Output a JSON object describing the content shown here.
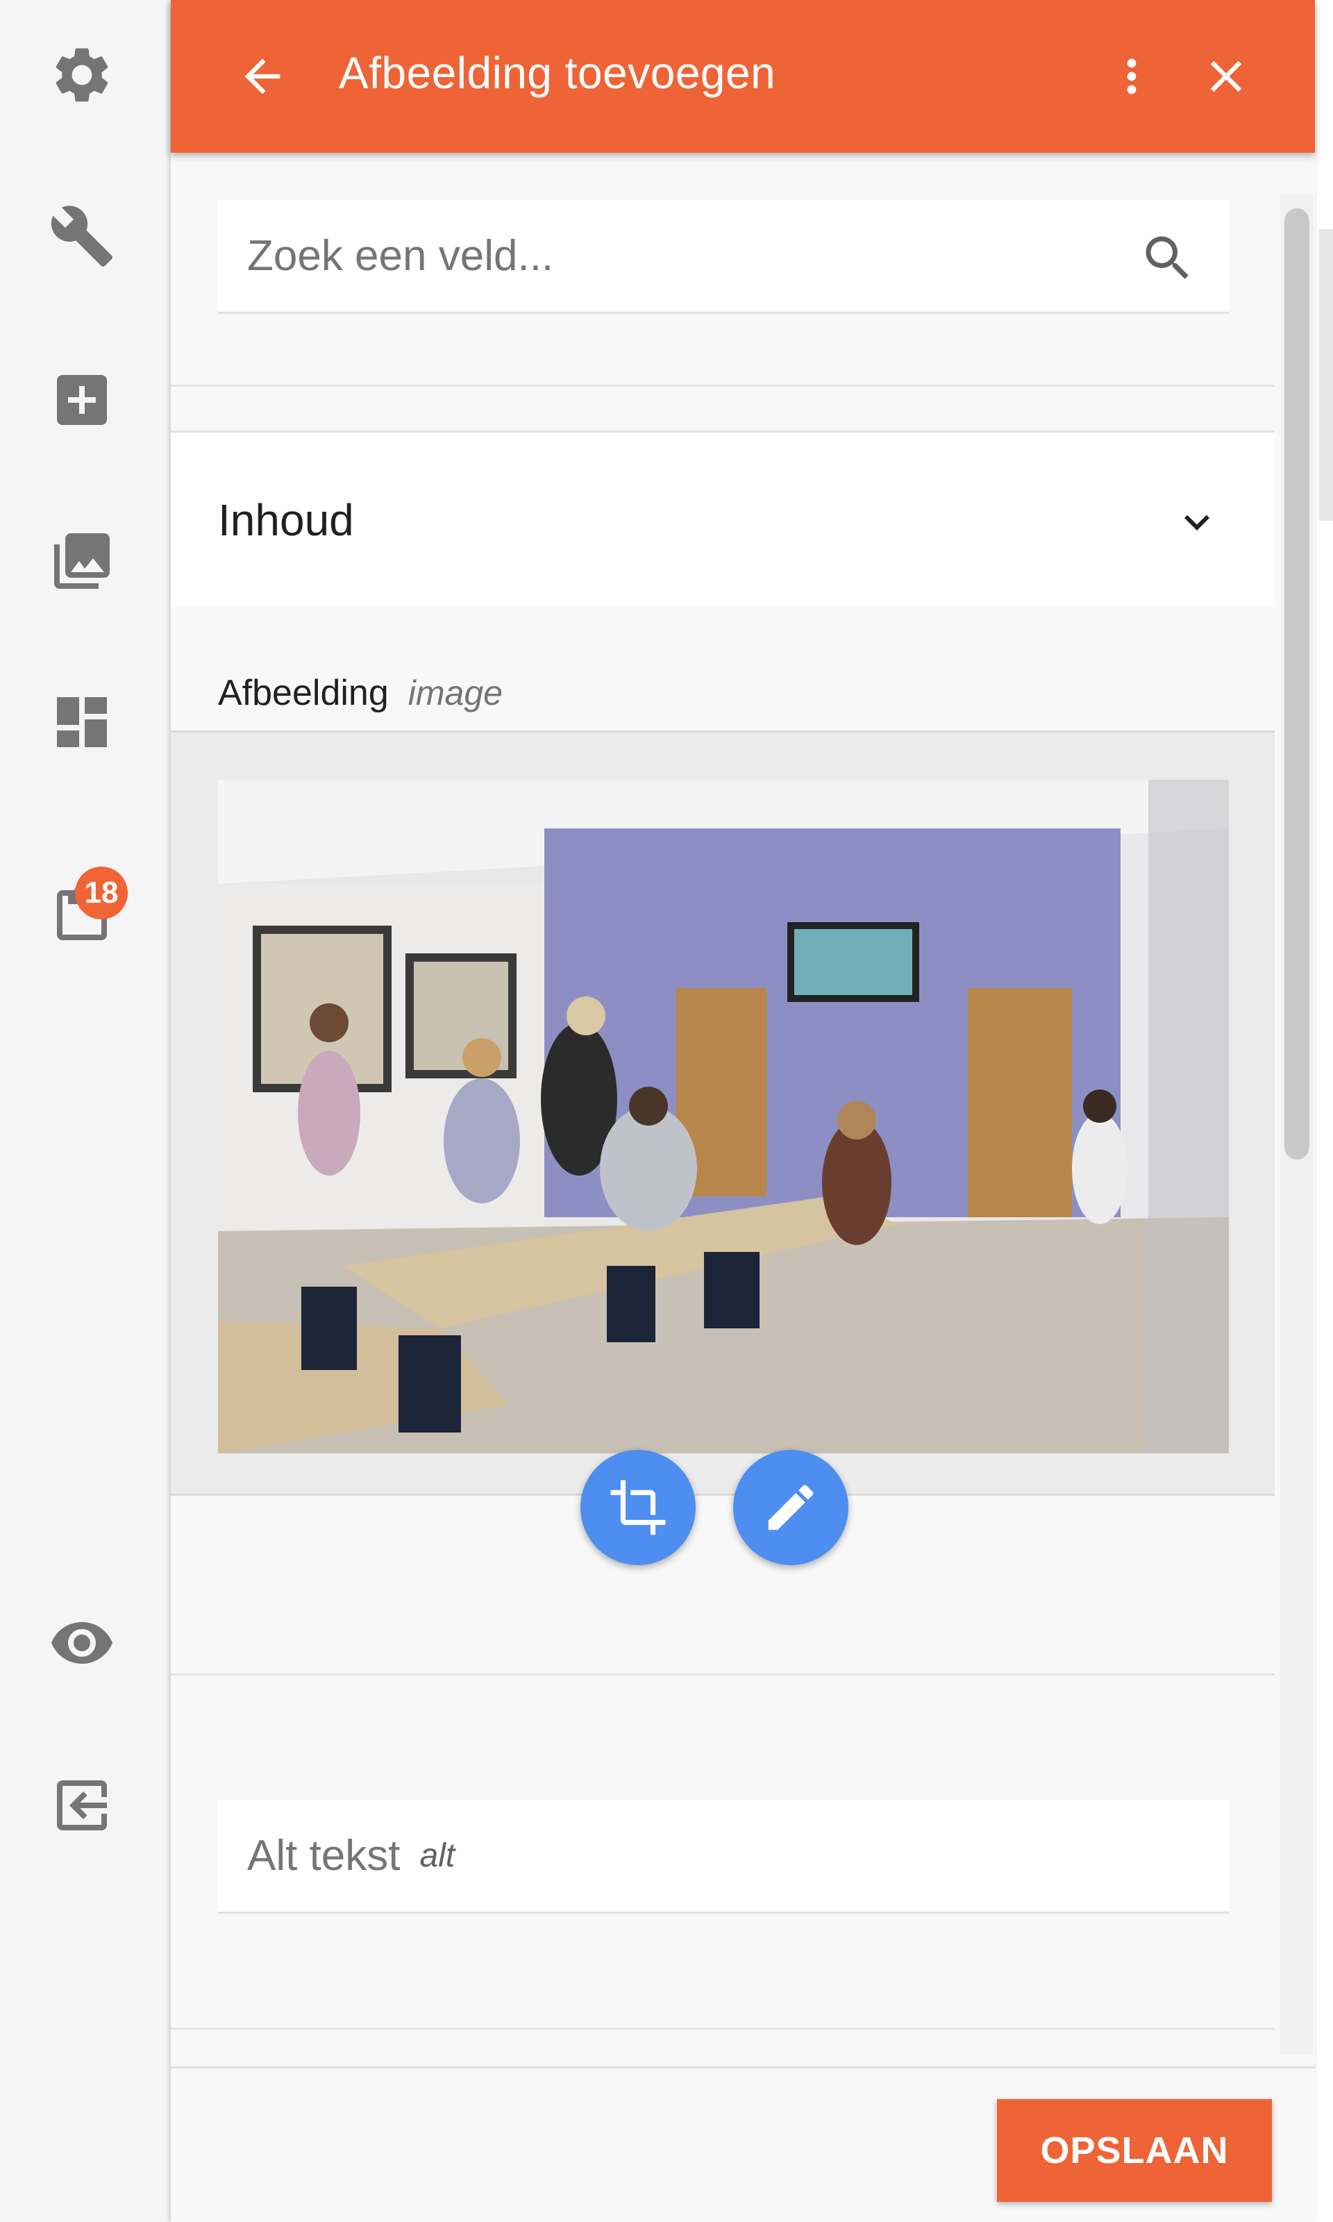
{
  "sidebar": {
    "items": [
      {
        "icon": "settings-icon"
      },
      {
        "icon": "wrench-icon"
      },
      {
        "icon": "add-box-icon"
      },
      {
        "icon": "photo-library-icon"
      },
      {
        "icon": "dashboard-icon"
      },
      {
        "icon": "clipboard-icon",
        "badge": "18"
      },
      {
        "icon": "eye-icon"
      },
      {
        "icon": "logout-icon"
      }
    ]
  },
  "panel": {
    "title": "Afbeelding toevoegen",
    "accent_color": "#ef6436",
    "search": {
      "placeholder": "Zoek een veld..."
    },
    "section": {
      "title": "Inhoud"
    },
    "image_field": {
      "label": "Afbeelding",
      "key": "image"
    },
    "alt_field": {
      "label": "Alt tekst",
      "key": "alt"
    },
    "fab_color": "#4d8ef0",
    "save_label": "OPSLAAN"
  }
}
